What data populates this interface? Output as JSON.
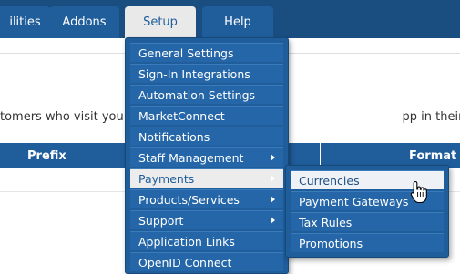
{
  "nav": {
    "tabs": [
      {
        "label": "ilities"
      },
      {
        "label": "Addons"
      },
      {
        "label": "Setup"
      },
      {
        "label": "Help"
      }
    ]
  },
  "page": {
    "description": "tomers who visit you                                                                          pp in their local currency."
  },
  "table": {
    "columns": [
      "Prefix",
      "Format"
    ]
  },
  "setup_menu": {
    "items": [
      {
        "label": "General Settings"
      },
      {
        "label": "Sign-In Integrations"
      },
      {
        "label": "Automation Settings"
      },
      {
        "label": "MarketConnect"
      },
      {
        "label": "Notifications"
      },
      {
        "label": "Staff Management"
      },
      {
        "label": "Payments"
      },
      {
        "label": "Products/Services"
      },
      {
        "label": "Support"
      },
      {
        "label": "Application Links"
      },
      {
        "label": "OpenID Connect"
      }
    ]
  },
  "payments_submenu": {
    "items": [
      {
        "label": "Currencies"
      },
      {
        "label": "Payment Gateways"
      },
      {
        "label": "Tax Rules"
      },
      {
        "label": "Promotions"
      }
    ]
  },
  "colors": {
    "nav_bg": "#1a4d80",
    "menu_bg": "#1f5d9b",
    "highlight": "#ececec"
  }
}
